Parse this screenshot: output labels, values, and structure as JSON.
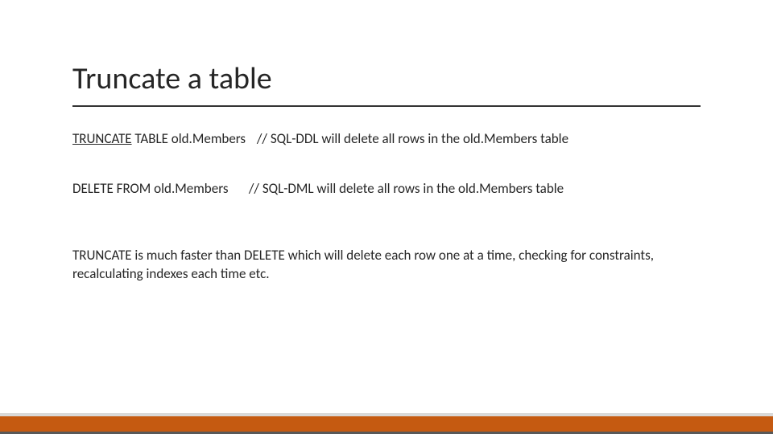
{
  "slide": {
    "title": "Truncate a table",
    "line1": {
      "keyword": "TRUNCATE",
      "rest": " TABLE old.Members",
      "comment": "// SQL-DDL will delete all rows in the old.Members table"
    },
    "line2": {
      "cmd": "DELETE FROM old.Members",
      "comment": "// SQL-DML will delete all rows in the old.Members table"
    },
    "paragraph": "TRUNCATE is much faster than DELETE which will delete each row one at a time, checking for constraints, recalculating indexes each time etc."
  }
}
